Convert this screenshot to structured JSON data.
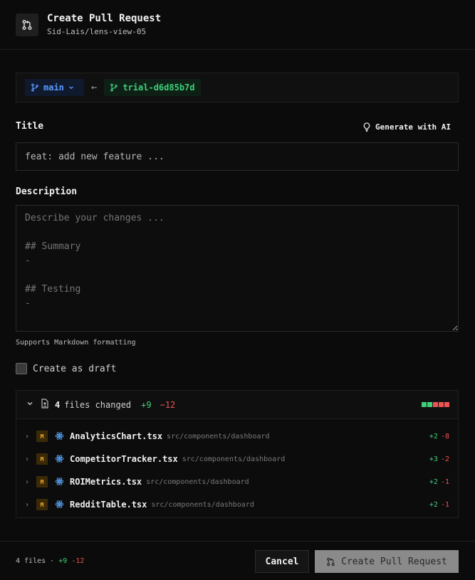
{
  "header": {
    "title": "Create Pull Request",
    "repo": "Sid-Lais/lens-view-05"
  },
  "branches": {
    "base": "main",
    "head": "trial-d6d85b7d"
  },
  "form": {
    "title_label": "Title",
    "generate_ai_label": "Generate with AI",
    "title_placeholder": "feat: add new feature ...",
    "description_label": "Description",
    "description_placeholder": "Describe your changes ...\n\n## Summary\n-\n\n## Testing\n-",
    "markdown_hint": "Supports Markdown formatting",
    "draft_label": "Create as draft",
    "draft_checked": false
  },
  "files": {
    "count": "4",
    "changed_label": "files changed",
    "additions": "+9",
    "deletions": "−12",
    "diffbar_colors": [
      "#3fd07a",
      "#3fd07a",
      "#f05252",
      "#f05252",
      "#f05252"
    ],
    "items": [
      {
        "status": "M",
        "name": "AnalyticsChart.tsx",
        "path": "src/components/dashboard",
        "add": "+2",
        "del": "-8"
      },
      {
        "status": "M",
        "name": "CompetitorTracker.tsx",
        "path": "src/components/dashboard",
        "add": "+3",
        "del": "-2"
      },
      {
        "status": "M",
        "name": "ROIMetrics.tsx",
        "path": "src/components/dashboard",
        "add": "+2",
        "del": "-1"
      },
      {
        "status": "M",
        "name": "RedditTable.tsx",
        "path": "src/components/dashboard",
        "add": "+2",
        "del": "-1"
      }
    ]
  },
  "footer": {
    "files_text": "4 files ·",
    "additions": "+9",
    "deletions": "-12",
    "cancel_label": "Cancel",
    "create_label": "Create Pull Request"
  },
  "colors": {
    "accent_blue": "#5b9bff",
    "accent_green": "#3fd07a",
    "accent_red": "#f05252",
    "modified_badge": "#f5a623"
  }
}
